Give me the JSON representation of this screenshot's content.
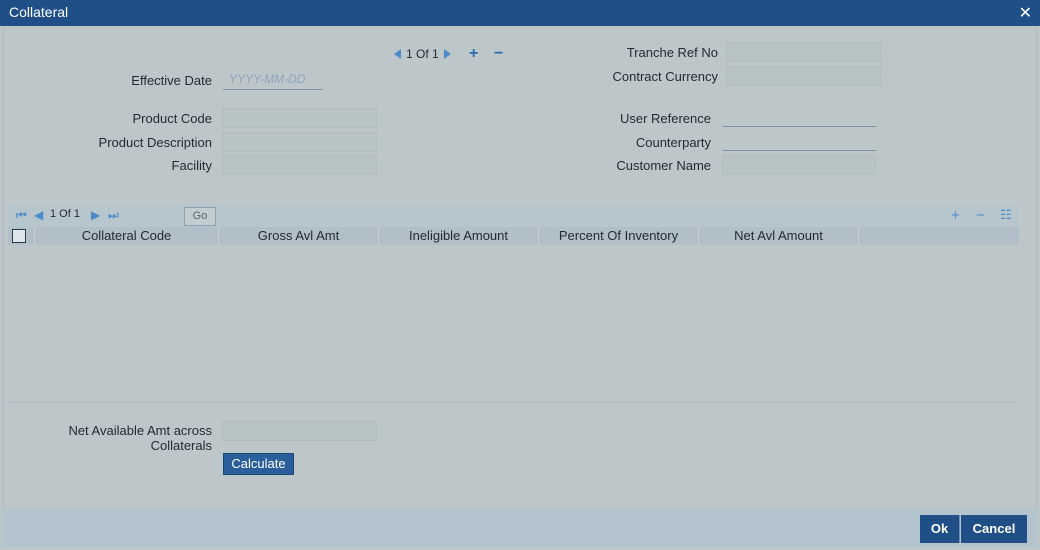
{
  "window": {
    "title": "Collateral",
    "close_glyph": "✕"
  },
  "record_pager": {
    "text": "1 Of 1",
    "add": "+",
    "remove": "−"
  },
  "fields": {
    "effective_date": {
      "label": "Effective Date",
      "placeholder": "YYYY-MM-DD"
    },
    "product_code": {
      "label": "Product Code"
    },
    "product_description": {
      "label": "Product Description"
    },
    "facility": {
      "label": "Facility"
    },
    "tranche_ref_no": {
      "label": "Tranche Ref No"
    },
    "contract_currency": {
      "label": "Contract Currency"
    },
    "user_reference": {
      "label": "User Reference"
    },
    "counterparty": {
      "label": "Counterparty"
    },
    "customer_name": {
      "label": "Customer Name"
    }
  },
  "grid": {
    "pager_text": "1 Of 1",
    "go_label": "Go",
    "columns": [
      "Collateral Code",
      "Gross Avl Amt",
      "Ineligible Amount",
      "Percent Of Inventory",
      "Net Avl Amount"
    ]
  },
  "net_available": {
    "label_line1": "Net Available Amt across",
    "label_line2": "Collaterals"
  },
  "buttons": {
    "calculate": "Calculate",
    "ok": "Ok",
    "cancel": "Cancel"
  },
  "colors": {
    "titlebar": "#1f4f86",
    "accent": "#4c8bc9",
    "button": "#2a5f9c"
  }
}
